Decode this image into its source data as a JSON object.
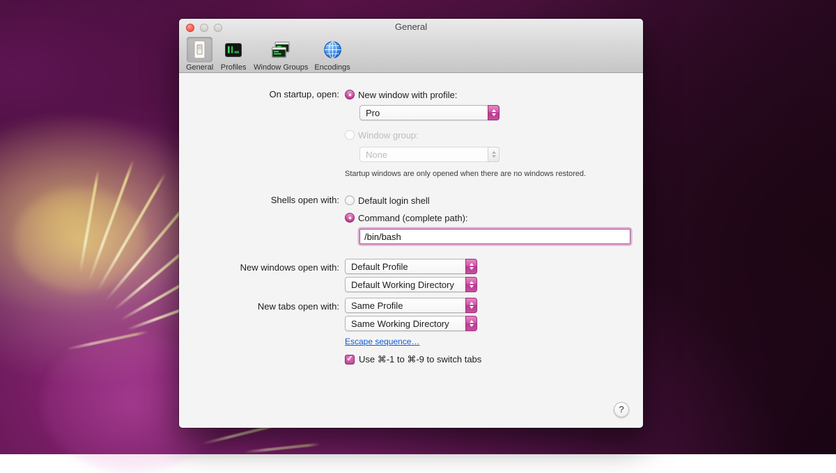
{
  "window": {
    "title": "General",
    "toolbar": {
      "items": [
        {
          "label": "General",
          "icon": "light-switch-icon",
          "selected": true
        },
        {
          "label": "Profiles",
          "icon": "terminal-profile-icon",
          "selected": false
        },
        {
          "label": "Window Groups",
          "icon": "window-groups-icon",
          "selected": false
        },
        {
          "label": "Encodings",
          "icon": "globe-icon",
          "selected": false
        }
      ]
    }
  },
  "form": {
    "startup": {
      "label": "On startup, open:",
      "new_window_radio": "New window with profile:",
      "profile_popup": "Pro",
      "window_group_radio": "Window group:",
      "window_group_popup": "None",
      "note": "Startup windows are only opened when there are no windows restored."
    },
    "shells": {
      "label": "Shells open with:",
      "default_radio": "Default login shell",
      "command_radio": "Command (complete path):",
      "command_value": "/bin/bash"
    },
    "new_windows": {
      "label": "New windows open with:",
      "profile_popup": "Default Profile",
      "directory_popup": "Default Working Directory"
    },
    "new_tabs": {
      "label": "New tabs open with:",
      "profile_popup": "Same Profile",
      "directory_popup": "Same Working Directory",
      "escape_link": "Escape sequence…",
      "switch_tabs_checkbox": "Use ⌘-1 to ⌘-9 to switch tabs"
    },
    "help_button": "?"
  },
  "colors": {
    "accent": "#c8479a",
    "link_blue": "#0b5bd3"
  }
}
